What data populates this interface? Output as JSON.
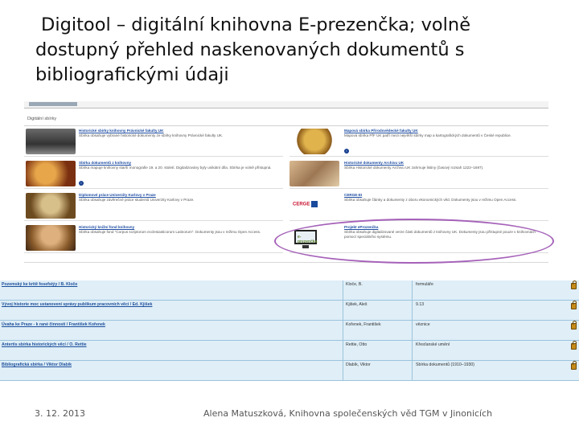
{
  "slide": {
    "title_lines": [
      "Digitool – digitální knihovna E-prezenčka; volně",
      "dostupný přehled naskenovaných dokumentů s",
      "bibliografickými údaji"
    ],
    "footer_date": "3. 12. 2013",
    "footer_author": "Alena Matuszková, Knihovna společenských věd TGM v Jinonicích"
  },
  "collections_screenshot": {
    "section_label": "Digitální sbírky",
    "left_entries": [
      {
        "title": "Historické sbírky knihovny Právnické fakulty UK",
        "desc": "Sbírka obsahuje vybrané historické dokumenty ze sbírky knihovny Právnické fakulty UK."
      },
      {
        "title": "Sbírka dokumentů z knihovny",
        "desc": "Sbírka mapuje knihovny starší monografie 19. a 20. století. Digitalizovány byly unikátní díla. Sbírka je volně přístupná."
      },
      {
        "title": "Diplomové práce Univerzity Karlovy v Praze",
        "desc": "Sbírka obsahuje závěrečné práce studentů Univerzity Karlovy v Praze."
      },
      {
        "title": "Historický knižní fond knihovny",
        "desc": "Sbírka obsahuje fond \"Corpus scriptorum ecclesiasticorum Latinorum\". Dokumenty jsou v režimu Open Access."
      }
    ],
    "right_entries": [
      {
        "title": "Mapová sbírka Přírodovědecké fakulty UK",
        "desc": "Mapová sbírka PřF UK patří mezi největší sbírky map a kartografických dokumentů v České republice."
      },
      {
        "title": "Historické dokumenty Archivu UK",
        "desc": "Sbírka Historické dokumenty Archivu UK zahrnuje listiny (časový rozsah 1222–1697)."
      },
      {
        "title": "CERGE-EI",
        "desc": "Sbírka obsahuje články a dokumenty z oboru ekonomických věd. Dokumenty jsou v režimu Open Access."
      },
      {
        "title": "Projekt eProzenčka",
        "desc": "Sbírka obsahuje digitalizované verze části dokumentů z knihovny UK. Dokumenty jsou přístupné pouze v knihovnách pomocí speciálního systému."
      }
    ],
    "monitor_brand": "e-prezenčka"
  },
  "bibliography_screenshot": {
    "rows": [
      {
        "title": "Pozemský ke kritě fosefstýy / B. Kloče",
        "author": "Kloče, B.",
        "subject": "formuláře"
      },
      {
        "title": "Vývoj historie moc ustanovení správy publikum pracovních věcí / Ed. Kjišek",
        "author": "Kjišek, Aleš",
        "subject": "9.13"
      },
      {
        "title": "Úvaha ke Praze - k rané činnosti / František Kořenek",
        "author": "Kořenek, František",
        "subject": "věznice"
      },
      {
        "title": "Antertis sbírka historických věcí / O. Rettie",
        "author": "Rettie, Otto",
        "subject": "Křesťanské umění"
      },
      {
        "title": "Bibliografická sbírka / Viktor Dlabík",
        "author": "Dlabík, Viktor",
        "subject": "Sbírka dokumentů (1910–1930)"
      }
    ]
  },
  "colors": {
    "highlight_ellipse": "#a561b9",
    "row_background": "#dfeef7",
    "link_blue": "#1f4ea3"
  }
}
